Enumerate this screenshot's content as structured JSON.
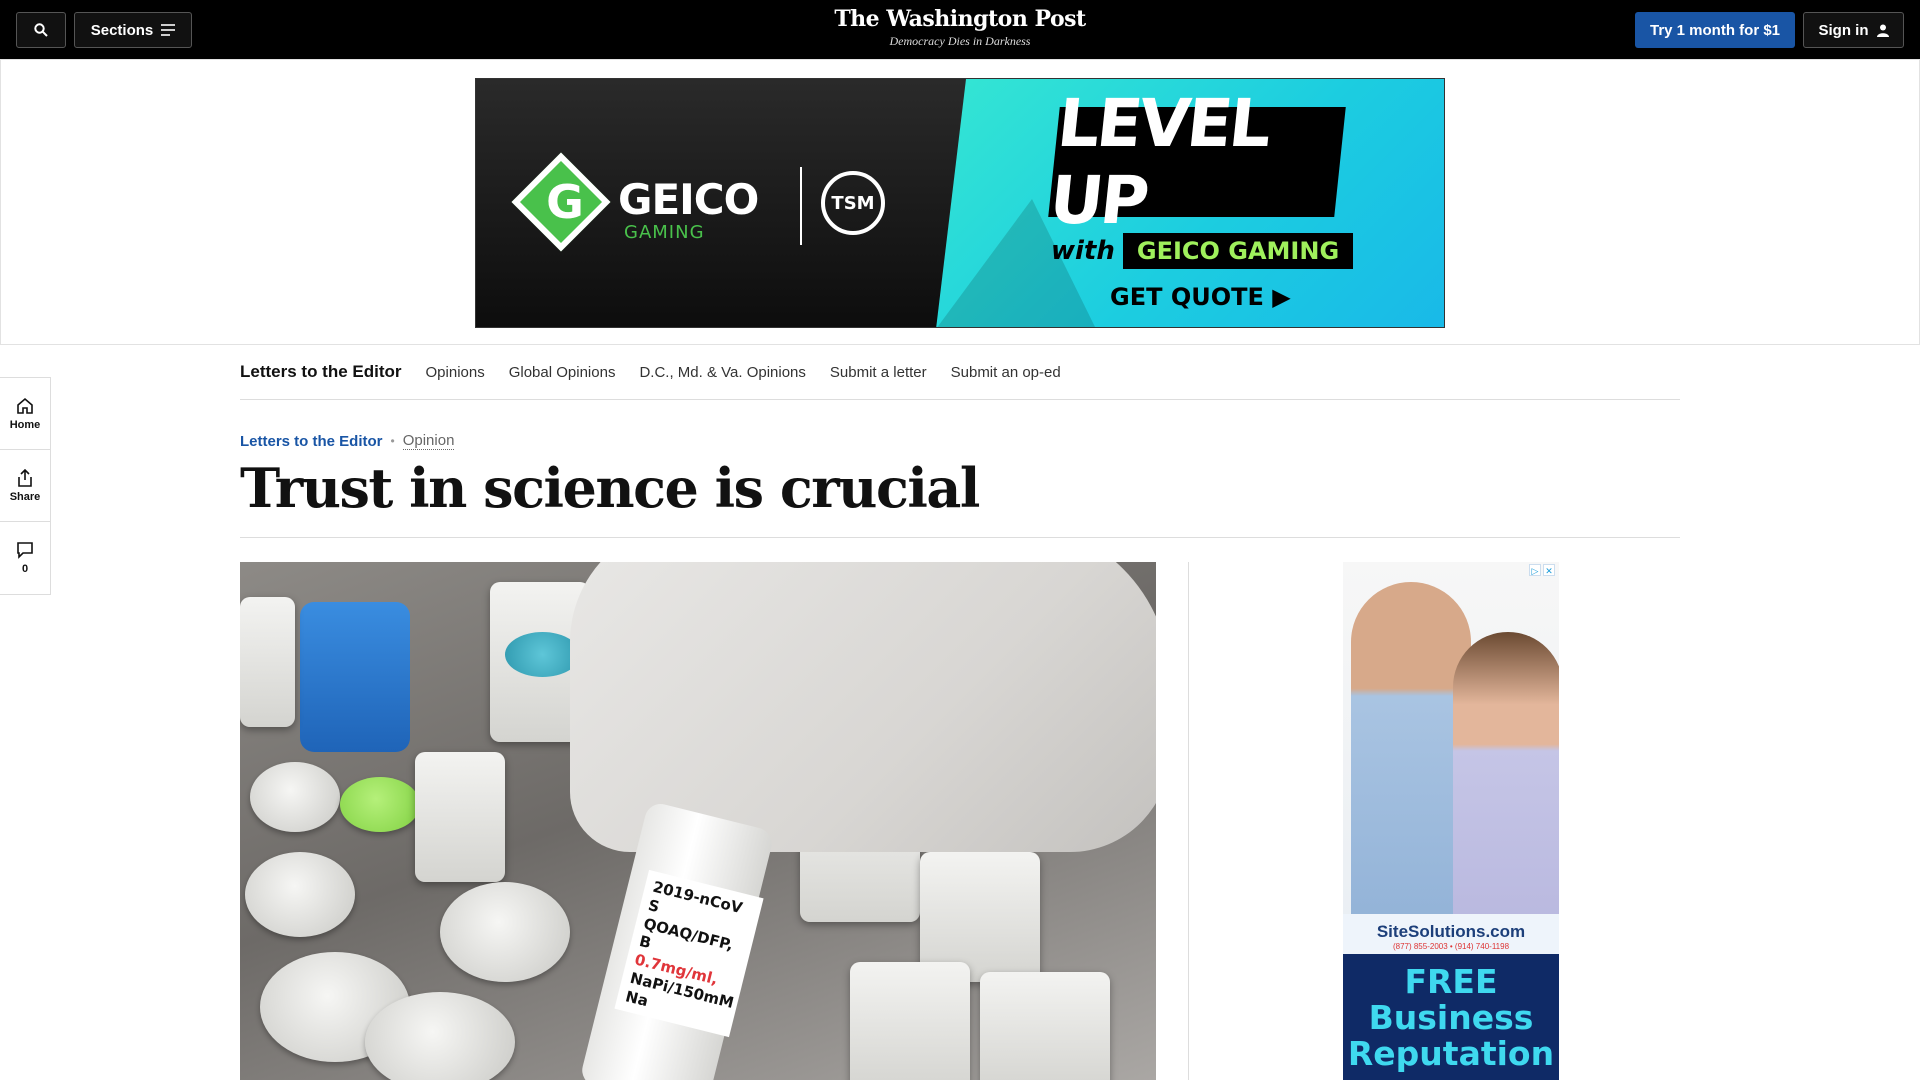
{
  "header": {
    "sections_label": "Sections",
    "brand_name": "The Washington Post",
    "brand_tagline": "Democracy Dies in Darkness",
    "subscribe_label": "Try 1 month for $1",
    "signin_label": "Sign in",
    "icons": [
      "search-icon",
      "menu-icon",
      "user-icon"
    ]
  },
  "top_ad": {
    "brand": "GEICO",
    "brand_sub": "GAMING",
    "partner": "TSM",
    "headline": "LEVEL UP",
    "with": "with",
    "pill": "GEICO GAMING",
    "cta": "GET QUOTE ▶"
  },
  "section_nav": {
    "primary": "Letters to the Editor",
    "links": [
      "Opinions",
      "Global Opinions",
      "D.C., Md. & Va. Opinions",
      "Submit a letter",
      "Submit an op-ed"
    ]
  },
  "rail": {
    "home": "Home",
    "share": "Share",
    "comments_count": "0",
    "icons": [
      "home-icon",
      "share-icon",
      "comment-icon"
    ]
  },
  "article": {
    "category": "Letters to the Editor",
    "label": "Opinion",
    "headline": "Trust in science is crucial"
  },
  "photo_label": {
    "line1": "2019-nCoV S",
    "line2": "QOAQ/DFP, B",
    "line3": "0.7mg/ml,",
    "line4": "NaPi/150mM Na"
  },
  "side_ad": {
    "site_name": "SiteSolutions.com",
    "phones": "(877) 855-2003 • (914) 740-1198",
    "promo": "FREE Business Reputation"
  },
  "colors": {
    "topbar": "#000000",
    "accent_blue": "#1955a5",
    "geico_green": "#49c14b",
    "ad_teal": "#1ccde0"
  }
}
